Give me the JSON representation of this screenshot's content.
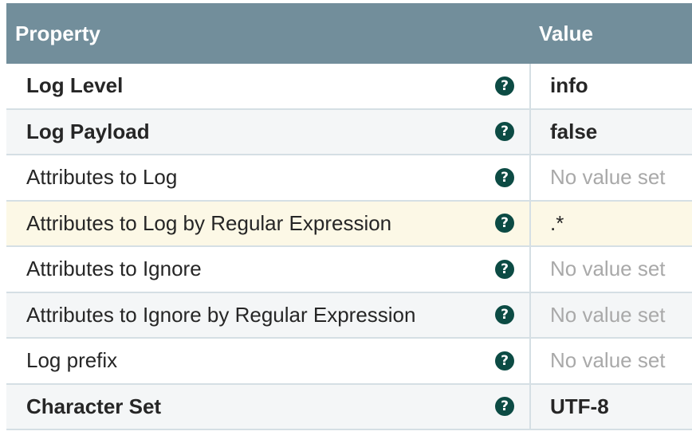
{
  "header": {
    "property_label": "Property",
    "value_label": "Value"
  },
  "help_icon_glyph": "?",
  "rows": [
    {
      "name": "Log Level",
      "value": "info",
      "bold": true,
      "placeholder": false
    },
    {
      "name": "Log Payload",
      "value": "false",
      "bold": true,
      "placeholder": false
    },
    {
      "name": "Attributes to Log",
      "value": "No value set",
      "bold": false,
      "placeholder": true
    },
    {
      "name": "Attributes to Log by Regular Expression",
      "value": ".*",
      "bold": false,
      "placeholder": false
    },
    {
      "name": "Attributes to Ignore",
      "value": "No value set",
      "bold": false,
      "placeholder": true
    },
    {
      "name": "Attributes to Ignore by Regular Expression",
      "value": "No value set",
      "bold": false,
      "placeholder": true
    },
    {
      "name": "Log prefix",
      "value": "No value set",
      "bold": false,
      "placeholder": true
    },
    {
      "name": "Character Set",
      "value": "UTF-8",
      "bold": true,
      "placeholder": false
    }
  ],
  "colors": {
    "header_bg": "#728e9b",
    "help_icon": "#0c4b44",
    "highlight_row": "#fcf8e6",
    "placeholder_text": "#a9a9a9"
  }
}
